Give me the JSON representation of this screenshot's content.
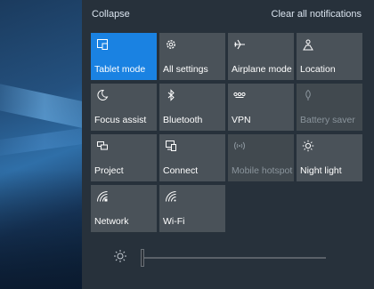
{
  "header": {
    "collapse_label": "Collapse",
    "clear_label": "Clear all notifications"
  },
  "tiles": [
    {
      "label": "Tablet mode",
      "icon": "tablet-mode-icon",
      "state": "on"
    },
    {
      "label": "All settings",
      "icon": "gear-icon",
      "state": "normal"
    },
    {
      "label": "Airplane mode",
      "icon": "airplane-icon",
      "state": "normal"
    },
    {
      "label": "Location",
      "icon": "location-icon",
      "state": "normal"
    },
    {
      "label": "Focus assist",
      "icon": "moon-icon",
      "state": "normal"
    },
    {
      "label": "Bluetooth",
      "icon": "bluetooth-icon",
      "state": "normal"
    },
    {
      "label": "VPN",
      "icon": "vpn-icon",
      "state": "normal"
    },
    {
      "label": "Battery saver",
      "icon": "battery-saver-icon",
      "state": "disabled"
    },
    {
      "label": "Project",
      "icon": "project-icon",
      "state": "normal"
    },
    {
      "label": "Connect",
      "icon": "connect-icon",
      "state": "normal"
    },
    {
      "label": "Mobile hotspot",
      "icon": "mobile-hotspot-icon",
      "state": "disabled"
    },
    {
      "label": "Night light",
      "icon": "sun-icon",
      "state": "normal"
    },
    {
      "label": "Network",
      "icon": "network-icon",
      "state": "normal"
    },
    {
      "label": "Wi-Fi",
      "icon": "wifi-icon",
      "state": "normal"
    }
  ],
  "brightness": {
    "icon": "brightness-icon",
    "level": 0
  },
  "colors": {
    "accent": "#1a82e2",
    "tile": "#4a5259",
    "panel": "#27313b"
  }
}
